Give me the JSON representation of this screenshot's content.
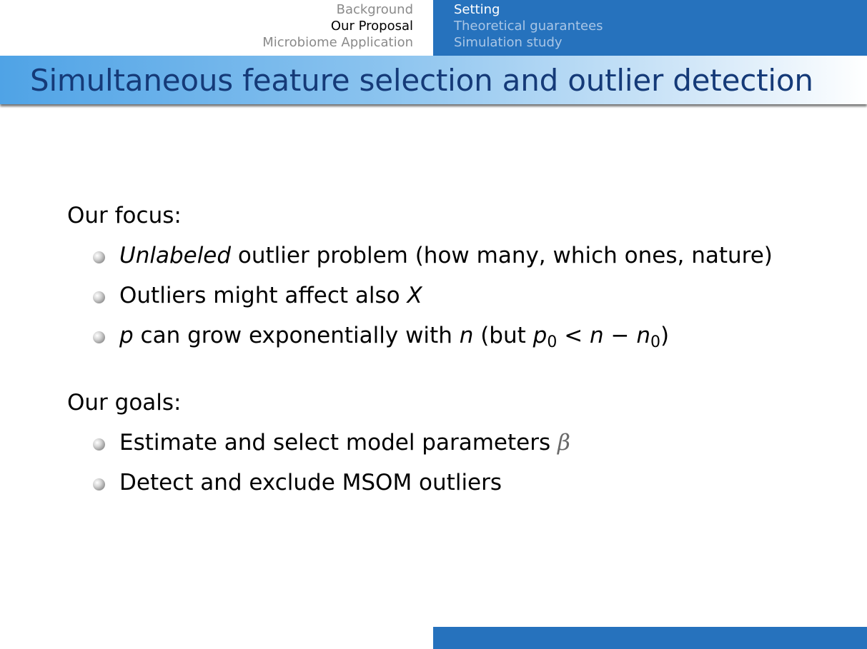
{
  "nav": {
    "sections": [
      {
        "label": "Background",
        "active": false
      },
      {
        "label": "Our Proposal",
        "active": true
      },
      {
        "label": "Microbiome Application",
        "active": false
      }
    ],
    "subsections": [
      {
        "label": "Setting",
        "active": true
      },
      {
        "label": "Theoretical guarantees",
        "active": false
      },
      {
        "label": "Simulation study",
        "active": false
      }
    ]
  },
  "slide": {
    "title": "Simultaneous feature selection and outlier detection",
    "focus": {
      "heading": "Our focus:",
      "item1_emph": "Unlabeled",
      "item1_rest": " outlier problem (how many, which ones, nature)",
      "item2_text": "Outliers might affect also ",
      "item2_var": "X",
      "item3_var_p": "p",
      "item3_text": " can grow exponentially with ",
      "item3_var_n": "n",
      "item3_paren_open": " (but ",
      "item3_p": "p",
      "item3_sub0": "0",
      "item3_lt": " < ",
      "item3_n": "n",
      "item3_minus": " − ",
      "item3_n2": "n",
      "item3_sub1": "0",
      "item3_paren_close": ")"
    },
    "goals": {
      "heading": "Our goals:",
      "item1_text": "Estimate and select model parameters ",
      "item1_greek": "β",
      "item2_text": "Detect and exclude MSOM outliers"
    }
  },
  "colors": {
    "nav_blue": "#2672bd",
    "title_text": "#153a78",
    "inactive_left": "#8a8a8a",
    "inactive_right": "#a9c6e6"
  }
}
